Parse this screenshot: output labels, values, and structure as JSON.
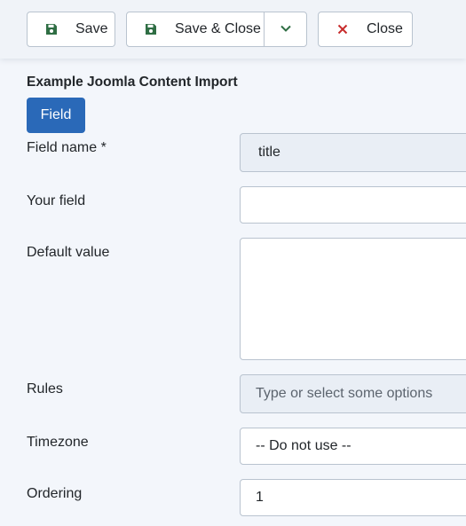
{
  "toolbar": {
    "save_label": "Save",
    "save_close_label": "Save & Close",
    "close_label": "Close",
    "colors": {
      "save_icon": "#2f6e44",
      "close_icon": "#c72b2b",
      "chevron": "#2f6e44"
    }
  },
  "form": {
    "title": "Example Joomla Content Import",
    "tab_label": "Field",
    "fields": {
      "field_name": {
        "label": "Field name *",
        "value": "title"
      },
      "your_field": {
        "label": "Your field",
        "value": ""
      },
      "default_value": {
        "label": "Default value",
        "value": ""
      },
      "rules": {
        "label": "Rules",
        "placeholder": "Type or select some options"
      },
      "timezone": {
        "label": "Timezone",
        "value": "-- Do not use --"
      },
      "ordering": {
        "label": "Ordering",
        "value": "1"
      }
    }
  },
  "colors": {
    "accent": "#2a69b8",
    "background": "#f3f6fb"
  }
}
